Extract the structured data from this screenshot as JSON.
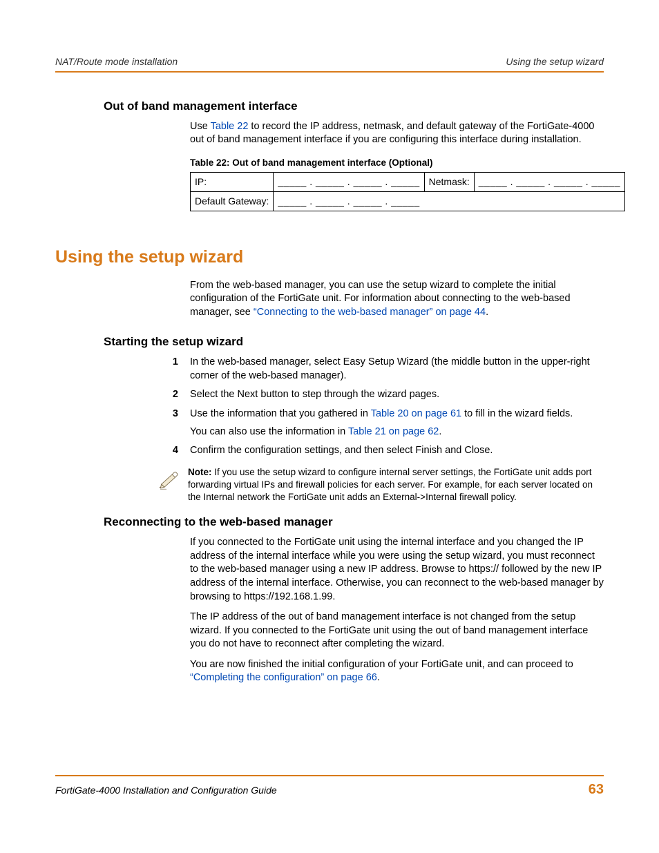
{
  "header": {
    "left": "NAT/Route mode installation",
    "right": "Using the setup wizard"
  },
  "s1": {
    "title": "Out of band management interface",
    "p1a": "Use ",
    "p1_link": "Table 22",
    "p1b": " to record the IP address, netmask, and default gateway of the FortiGate-4000 out of band management interface if you are configuring this interface during installation.",
    "table_caption": "Table 22: Out of band management interface (Optional)",
    "ip_label": "IP:",
    "netmask_label": "Netmask:",
    "gateway_label": "Default Gateway:",
    "blanks": "_____ . _____ . _____ . _____"
  },
  "h1": "Using the setup wizard",
  "intro": {
    "a": "From the web-based manager, you can use the setup wizard to complete the initial configuration of the FortiGate unit. For information about connecting to the web-based manager, see ",
    "link": "“Connecting to the web-based manager” on page 44",
    "b": "."
  },
  "s2": {
    "title": "Starting the setup wizard",
    "steps": {
      "n1": "1",
      "t1": "In the web-based manager, select Easy Setup Wizard (the middle button in the upper-right corner of the web-based manager).",
      "n2": "2",
      "t2": "Select the Next button to step through the wizard pages.",
      "n3": "3",
      "t3a": "Use the information that you gathered in ",
      "t3_link1": "Table 20 on page 61",
      "t3b": " to fill in the wizard fields.",
      "t3c": "You can also use the information in ",
      "t3_link2": "Table 21 on page 62",
      "t3d": ".",
      "n4": "4",
      "t4": "Confirm the configuration settings, and then select Finish and Close."
    },
    "note_label": "Note:",
    "note_body": " If you use the setup wizard to configure internal server settings, the FortiGate unit adds port forwarding virtual IPs and firewall policies for each server. For example, for each server located on the Internal network the FortiGate unit adds an External->Internal firewall policy."
  },
  "s3": {
    "title": "Reconnecting to the web-based manager",
    "p1": "If you connected to the FortiGate unit using the internal interface and you changed the IP address of the internal interface while you were using the setup wizard, you must reconnect to the web-based manager using a new IP address. Browse to https:// followed by the new IP address of the internal interface. Otherwise, you can reconnect to the web-based manager by browsing to https://192.168.1.99.",
    "p2": "The IP address of the out of band management interface is not changed from the setup wizard. If you connected to the FortiGate unit using the out of band management interface you do not have to reconnect after completing the wizard.",
    "p3a": "You are now finished the initial configuration of your FortiGate unit, and can proceed to ",
    "p3_link": "“Completing the configuration” on page 66",
    "p3b": "."
  },
  "footer": {
    "left": "FortiGate-4000 Installation and Configuration Guide",
    "page": "63"
  }
}
